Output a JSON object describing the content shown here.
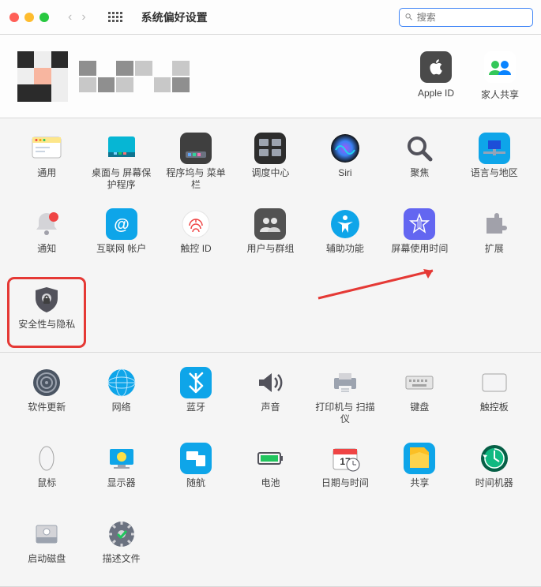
{
  "toolbar": {
    "title": "系统偏好设置",
    "search_placeholder": "搜索"
  },
  "account": {
    "apple_id_label": "Apple ID",
    "family_sharing_label": "家人共享"
  },
  "section1": [
    {
      "key": "general",
      "label": "通用"
    },
    {
      "key": "desktop",
      "label": "桌面与\n屏幕保护程序"
    },
    {
      "key": "dock",
      "label": "程序坞与\n菜单栏"
    },
    {
      "key": "mission",
      "label": "调度中心"
    },
    {
      "key": "siri",
      "label": "Siri"
    },
    {
      "key": "spotlight",
      "label": "聚焦"
    },
    {
      "key": "language",
      "label": "语言与地区"
    },
    {
      "key": "notifications",
      "label": "通知"
    },
    {
      "key": "internet",
      "label": "互联网\n帐户"
    },
    {
      "key": "touchid",
      "label": "触控 ID"
    },
    {
      "key": "users",
      "label": "用户与群组"
    },
    {
      "key": "accessibility",
      "label": "辅助功能"
    },
    {
      "key": "screentime",
      "label": "屏幕使用时间"
    },
    {
      "key": "extensions",
      "label": "扩展"
    },
    {
      "key": "security",
      "label": "安全性与隐私",
      "highlight": true
    }
  ],
  "section2": [
    {
      "key": "update",
      "label": "软件更新"
    },
    {
      "key": "network",
      "label": "网络"
    },
    {
      "key": "bluetooth",
      "label": "蓝牙"
    },
    {
      "key": "sound",
      "label": "声音"
    },
    {
      "key": "printers",
      "label": "打印机与\n扫描仪"
    },
    {
      "key": "keyboard",
      "label": "键盘"
    },
    {
      "key": "trackpad",
      "label": "触控板"
    },
    {
      "key": "mouse",
      "label": "鼠标"
    },
    {
      "key": "displays",
      "label": "显示器"
    },
    {
      "key": "sidecar",
      "label": "随航"
    },
    {
      "key": "battery",
      "label": "电池"
    },
    {
      "key": "datetime",
      "label": "日期与时间"
    },
    {
      "key": "sharing",
      "label": "共享"
    },
    {
      "key": "timemachine",
      "label": "时间机器"
    },
    {
      "key": "startup",
      "label": "启动磁盘"
    },
    {
      "key": "profiles",
      "label": "描述文件"
    }
  ]
}
